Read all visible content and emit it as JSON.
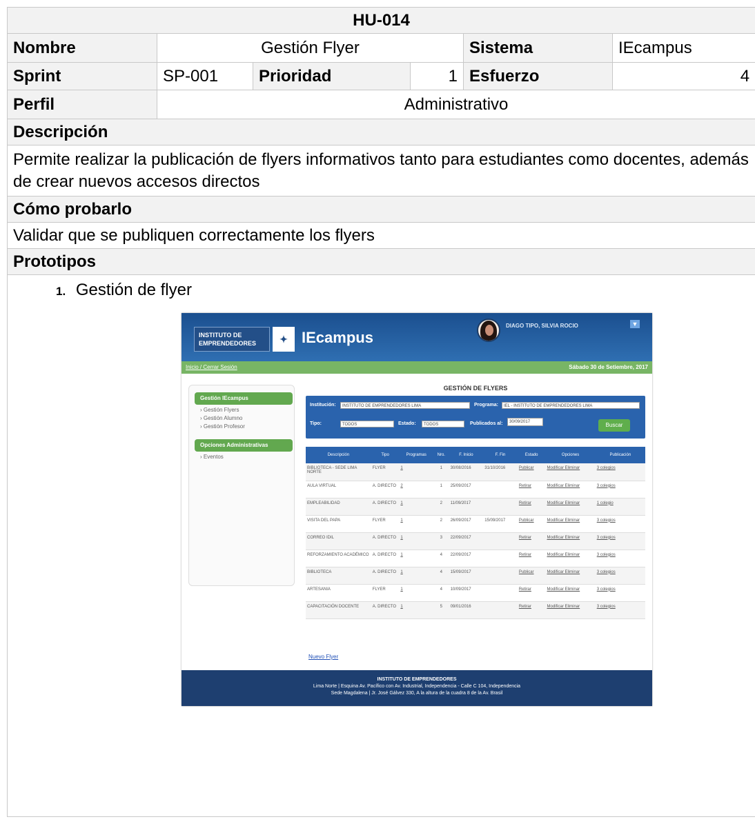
{
  "document": {
    "code": "HU-014",
    "nombre_label": "Nombre",
    "nombre_value": "Gestión Flyer",
    "sistema_label": "Sistema",
    "sistema_value": "IEcampus",
    "sprint_label": "Sprint",
    "sprint_value": "SP-001",
    "prioridad_label": "Prioridad",
    "prioridad_value": "1",
    "esfuerzo_label": "Esfuerzo",
    "esfuerzo_value": "4",
    "perfil_label": "Perfil",
    "perfil_value": "Administrativo",
    "descripcion_label": "Descripción",
    "descripcion_value": "Permite realizar la publicación de flyers informativos tanto para estudiantes como docentes, además de crear nuevos accesos directos",
    "como_probarlo_label": "Cómo probarlo",
    "como_probarlo_value": "Validar que se publiquen correctamente los flyers",
    "prototipos_label": "Prototipos",
    "prototype_number": "1.",
    "prototype_caption": "Gestión de flyer"
  },
  "prototype": {
    "logo_text": "INSTITUTO DE EMPRENDEDORES",
    "brand": "IEcampus",
    "user_name": "DIAGO TIPO, SILVIA ROCIO",
    "breadcrumb": "Inicio / Cerrar Sesión",
    "date": "Sábado 30 de Setiembre, 2017",
    "sidebar": [
      {
        "heading": "Gestión IEcampus",
        "items": [
          "Gestión Flyers",
          "Gestión Alumno",
          "Gestión Profesor"
        ]
      },
      {
        "heading": "Opciones Administrativas",
        "items": [
          "Eventos"
        ]
      }
    ],
    "title": "GESTIÓN DE FLYERS",
    "filters": {
      "institucion_label": "Institución:",
      "institucion_value": "INSTITUTO DE EMPRENDEDORES LIMA",
      "programa_label": "Programa:",
      "programa_value": "IEL - INSTITUTO DE EMPRENDEDORES LIMA",
      "tipo_label": "Tipo:",
      "tipo_value": "TODOS",
      "estado_label": "Estado:",
      "estado_value": "TODOS",
      "publicados_label": "Publicados al:",
      "publicados_value": "30/09/2017",
      "search_button": "Buscar"
    },
    "columns": [
      "Descripción",
      "Tipo",
      "Programas",
      "Nro.",
      "F. Inicio",
      "F. Fin",
      "Estado",
      "Opciones",
      "Publicación"
    ],
    "rows": [
      [
        "BIBLIOTECA - SEDE LIMA NORTE",
        "FLYER",
        "1",
        "1",
        "30/08/2016",
        "31/10/2016",
        "Publicar",
        "Modificar Eliminar",
        "3 colegios"
      ],
      [
        "AULA VIRTUAL",
        "A. DIRECTO",
        "2",
        "1",
        "25/09/2017",
        "",
        "Retirar",
        "Modificar Eliminar",
        "3 colegios"
      ],
      [
        "EMPLEABILIDAD",
        "A. DIRECTO",
        "1",
        "2",
        "11/09/2017",
        "",
        "Retirar",
        "Modificar Eliminar",
        "1 colegio"
      ],
      [
        "VISITA DEL PAPA",
        "FLYER",
        "1",
        "2",
        "26/09/2017",
        "15/09/2017",
        "Publicar",
        "Modificar Eliminar",
        "3 colegios"
      ],
      [
        "CORREO IDIL",
        "A. DIRECTO",
        "1",
        "3",
        "22/09/2017",
        "",
        "Retirar",
        "Modificar Eliminar",
        "3 colegios"
      ],
      [
        "REFORZAMIENTO ACADÉMICO",
        "A. DIRECTO",
        "1",
        "4",
        "22/09/2017",
        "",
        "Retirar",
        "Modificar Eliminar",
        "3 colegios"
      ],
      [
        "BIBLIOTECA",
        "A. DIRECTO",
        "1",
        "4",
        "15/09/2017",
        "",
        "Publicar",
        "Modificar Eliminar",
        "3 colegios"
      ],
      [
        "ARTESANIA",
        "FLYER",
        "1",
        "4",
        "10/09/2017",
        "",
        "Retirar",
        "Modificar Eliminar",
        "3 colegios"
      ],
      [
        "CAPACITACIÓN DOCENTE",
        "A. DIRECTO",
        "1",
        "5",
        "09/01/2016",
        "",
        "Retirar",
        "Modificar Eliminar",
        "3 colegios"
      ]
    ],
    "new_link": "Nuevo Flyer",
    "footer_title": "INSTITUTO DE EMPRENDEDORES",
    "footer_line1": "Lima Norte | Esquina Av. Pacífico con Av. Industrial, Independencia - Calle C 104, Independencia",
    "footer_line2": "Sede Magdalena | Jr. José Gálvez 330, A la altura de la cuadra 8 de la Av. Brasil"
  }
}
